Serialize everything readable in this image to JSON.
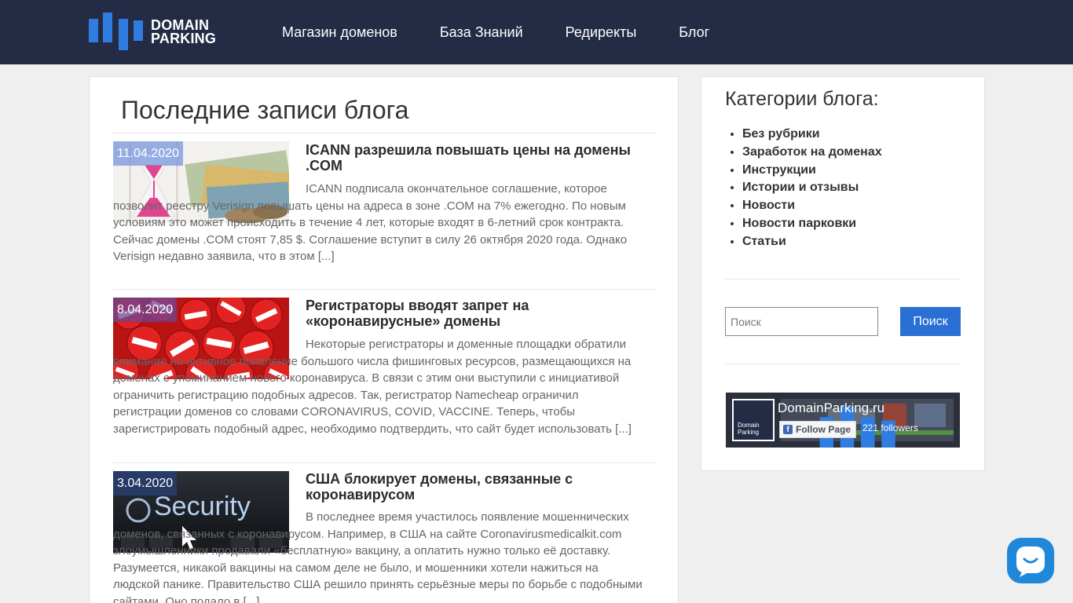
{
  "header": {
    "logo_line1": "DOMAIN",
    "logo_line2": "PARKING",
    "nav": [
      {
        "label": "Магазин доменов"
      },
      {
        "label": "База Знаний"
      },
      {
        "label": "Редиректы"
      },
      {
        "label": "Блог"
      }
    ]
  },
  "main": {
    "title": "Последние записи блога",
    "posts": [
      {
        "date": "11.04.2020",
        "title": "ICANN разрешила повышать цены на домены .COM",
        "excerpt": "ICANN подписала окончательное соглашение, которое позволит реестру Verisign повышать цены на адреса в зоне .COM на 7% ежегодно. По новым условиям это может происходить в течение 4 лет, которые входят в 6-летний срок контракта. Сейчас домены .COM стоят 7,85 $. Соглашение вступит в силу 26 октября 2020 года. Однако Verisign недавно заявила, что в этом [...]",
        "image_icon": "hourglass-money-image"
      },
      {
        "date": "8.04.2020",
        "title": "Регистраторы вводят запрет на «коронавирусные» домены",
        "excerpt": "Некоторые регистраторы и доменные площадки обратили внимание на активное появление большого числа фишинговых ресурсов, размещающихся на доменах с упоминанием нового коронавируса. В связи с этим они выступили с инициативой ограничить регистрацию подобных адресов. Так, регистратор Namecheap ограничил регистрации доменов со словами CORONAVIRUS, COVID, VACCINE. Теперь, чтобы зарегистрировать подобный адрес, необходимо подтвердить, что сайт будет использовать [...]",
        "image_icon": "stop-signs-image"
      },
      {
        "date": "3.04.2020",
        "title": "США блокирует домены, связанные с коронавирусом",
        "excerpt": "В последнее время участилось появление мошеннических доменов, связанных с коронавирусом. Например, в США на сайте Coronavirusmedicalkit.com злоумышленники продавали «бесплатную» вакцину, а оплатить нужно только её доставку. Разумеется, никакой вакцины на самом деле не было, и мошенники хотели нажиться на людской панике. Правительство США решило принять серьёзные меры по борьбе с подобными сайтами. Оно подало в [...]",
        "image_text": "Security",
        "image_icon": "security-keyboard-image"
      }
    ]
  },
  "sidebar": {
    "title": "Категории блога:",
    "categories": [
      "Без рубрики",
      "Заработок на доменах",
      "Инструкции",
      "Истории и отзывы",
      "Новости",
      "Новости парковки",
      "Статьи"
    ],
    "search": {
      "placeholder": "Поиск",
      "button": "Поиск"
    },
    "facebook": {
      "page_name": "DomainParking.ru",
      "logo_line1": "Domain",
      "logo_line2": "Parking",
      "follow_label": "Follow Page",
      "followers": "221 followers"
    }
  },
  "chat_widget": {
    "icon": "chat-bubble-icon"
  },
  "colors": {
    "header_bg": "#232b45",
    "brand_blue": "#2f7de1",
    "button_blue": "#2a6fd3",
    "chat_blue": "#1f88d9"
  }
}
